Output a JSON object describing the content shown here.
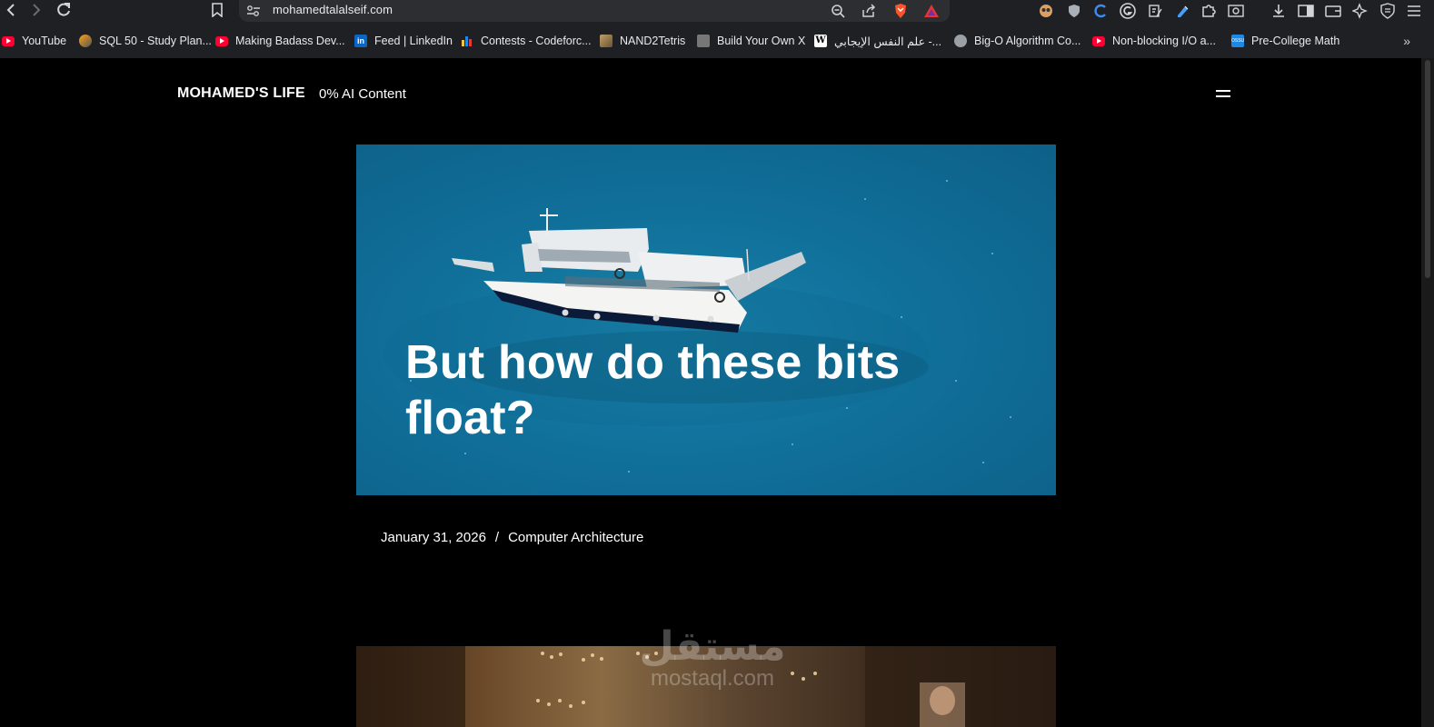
{
  "browser": {
    "url": "mohamedtalalseif.com",
    "bookmarks": [
      {
        "label": "YouTube",
        "icon": "youtube-icon"
      },
      {
        "label": "SQL 50 - Study Plan...",
        "icon": "leetcode-icon"
      },
      {
        "label": "Making Badass Dev...",
        "icon": "youtube-icon"
      },
      {
        "label": "Feed | LinkedIn",
        "icon": "linkedin-icon"
      },
      {
        "label": "Contests - Codeforc...",
        "icon": "codeforces-icon"
      },
      {
        "label": "NAND2Tetris",
        "icon": "nand2tetris-icon"
      },
      {
        "label": "Build Your Own X",
        "icon": "github-icon"
      },
      {
        "label": "علم النفس الإيجابي -...",
        "icon": "wikipedia-icon"
      },
      {
        "label": "Big-O Algorithm Co...",
        "icon": "globe-icon"
      },
      {
        "label": "Non-blocking I/O a...",
        "icon": "youtube-icon"
      },
      {
        "label": "Pre-College Math",
        "icon": "ossu-icon"
      }
    ],
    "more_bookmarks": "»"
  },
  "site": {
    "title": "MOHAMED'S LIFE",
    "tagline": "0% AI Content"
  },
  "post": {
    "title": "But how do these bits float?",
    "date": "January 31, 2026",
    "separator": "/",
    "category": "Computer Architecture"
  },
  "watermark": {
    "arabic": "مستقل",
    "latin": "mostaql.com"
  },
  "colors": {
    "page_background": "#000000",
    "chrome_background": "#1f2023",
    "urlbar_background": "#2d2e32",
    "sea": "#1584ad"
  }
}
